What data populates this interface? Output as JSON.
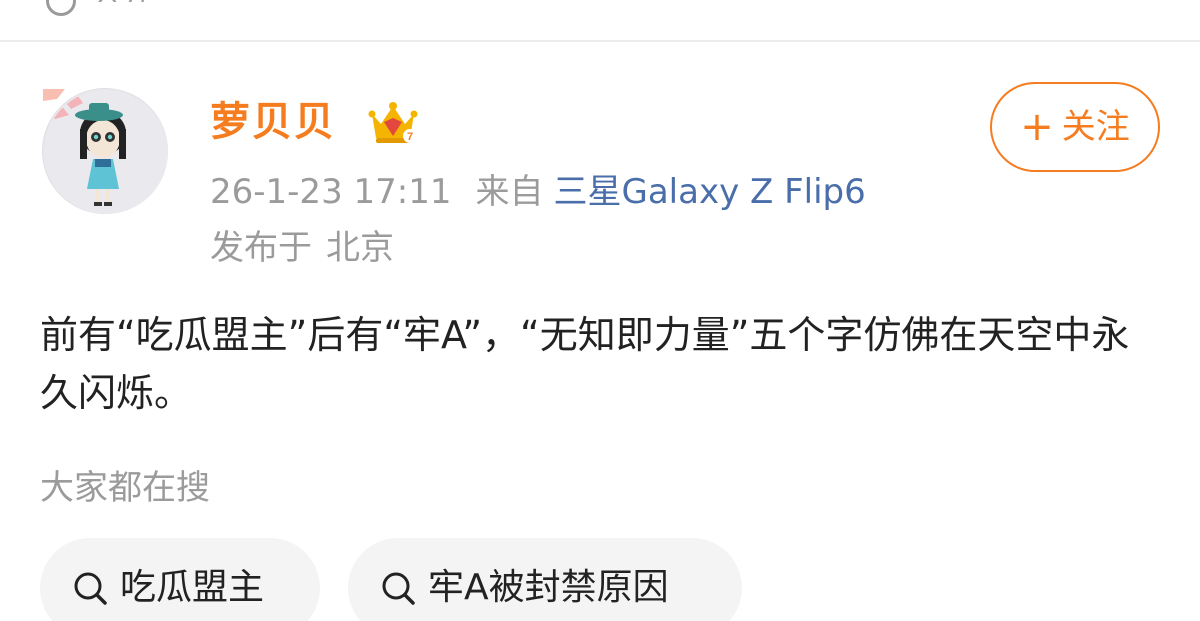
{
  "top_bar": {
    "icon": "share-icon",
    "label": "公开"
  },
  "post": {
    "author": {
      "name": "萝贝贝",
      "badge_icon": "crown-icon",
      "badge_level": "7",
      "avatar_icon": "cartoon-avatar"
    },
    "meta": {
      "time": "26-1-23 17:11",
      "source_prefix": "来自",
      "device": "三星Galaxy Z Flip6",
      "location_prefix": "发布于",
      "location": "北京"
    },
    "follow": {
      "icon": "plus-icon",
      "label": "关注"
    },
    "body_text": "前有“吃瓜盟主”后有“牢A”，“无知即力量”五个字仿佛在天空中永久闪烁。"
  },
  "trending": {
    "title": "大家都在搜",
    "chips": [
      {
        "icon": "search-icon",
        "label": "吃瓜盟主"
      },
      {
        "icon": "search-icon",
        "label": "牢A被封禁原因"
      }
    ]
  },
  "colors": {
    "accent_orange": "#f57c1f",
    "link_blue": "#4a6ea9",
    "muted_gray": "#9b9b9b",
    "chip_bg": "#f4f4f5",
    "divider": "#ececec"
  }
}
